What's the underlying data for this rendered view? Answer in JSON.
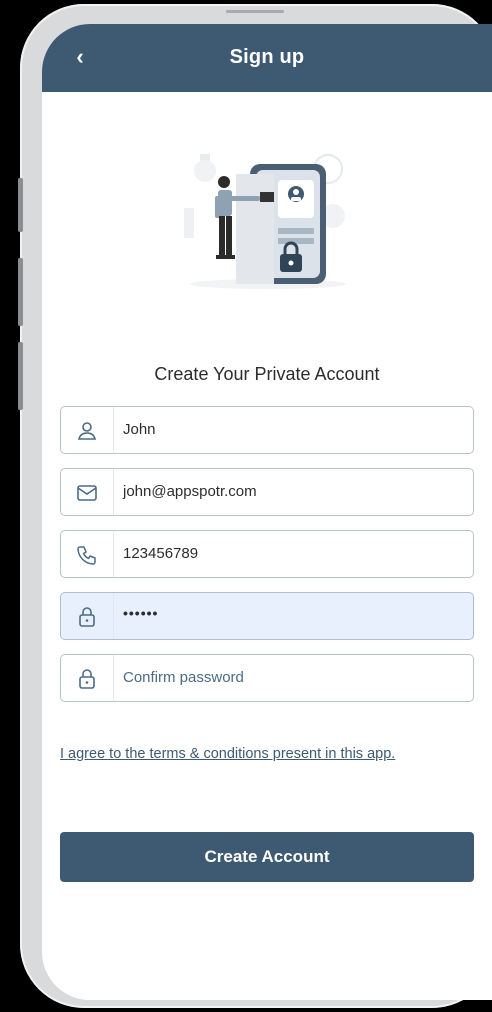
{
  "header": {
    "title": "Sign up",
    "back_icon": "chevron-left-icon"
  },
  "main": {
    "heading": "Create Your Private Account",
    "fields": [
      {
        "icon": "user-icon",
        "value": "John"
      },
      {
        "icon": "mail-icon",
        "value": "john@appspotr.com"
      },
      {
        "icon": "phone-icon",
        "value": "123456789"
      },
      {
        "icon": "lock-icon",
        "value": "••••••"
      },
      {
        "icon": "lock-icon",
        "placeholder": "Confirm password",
        "value": ""
      }
    ],
    "terms": "I agree to the terms & conditions present in this app.",
    "submit_label": "Create Account"
  },
  "colors": {
    "primary": "#3e5a73",
    "autofill": "#e8f0fe",
    "border": "#b9c3cf"
  }
}
